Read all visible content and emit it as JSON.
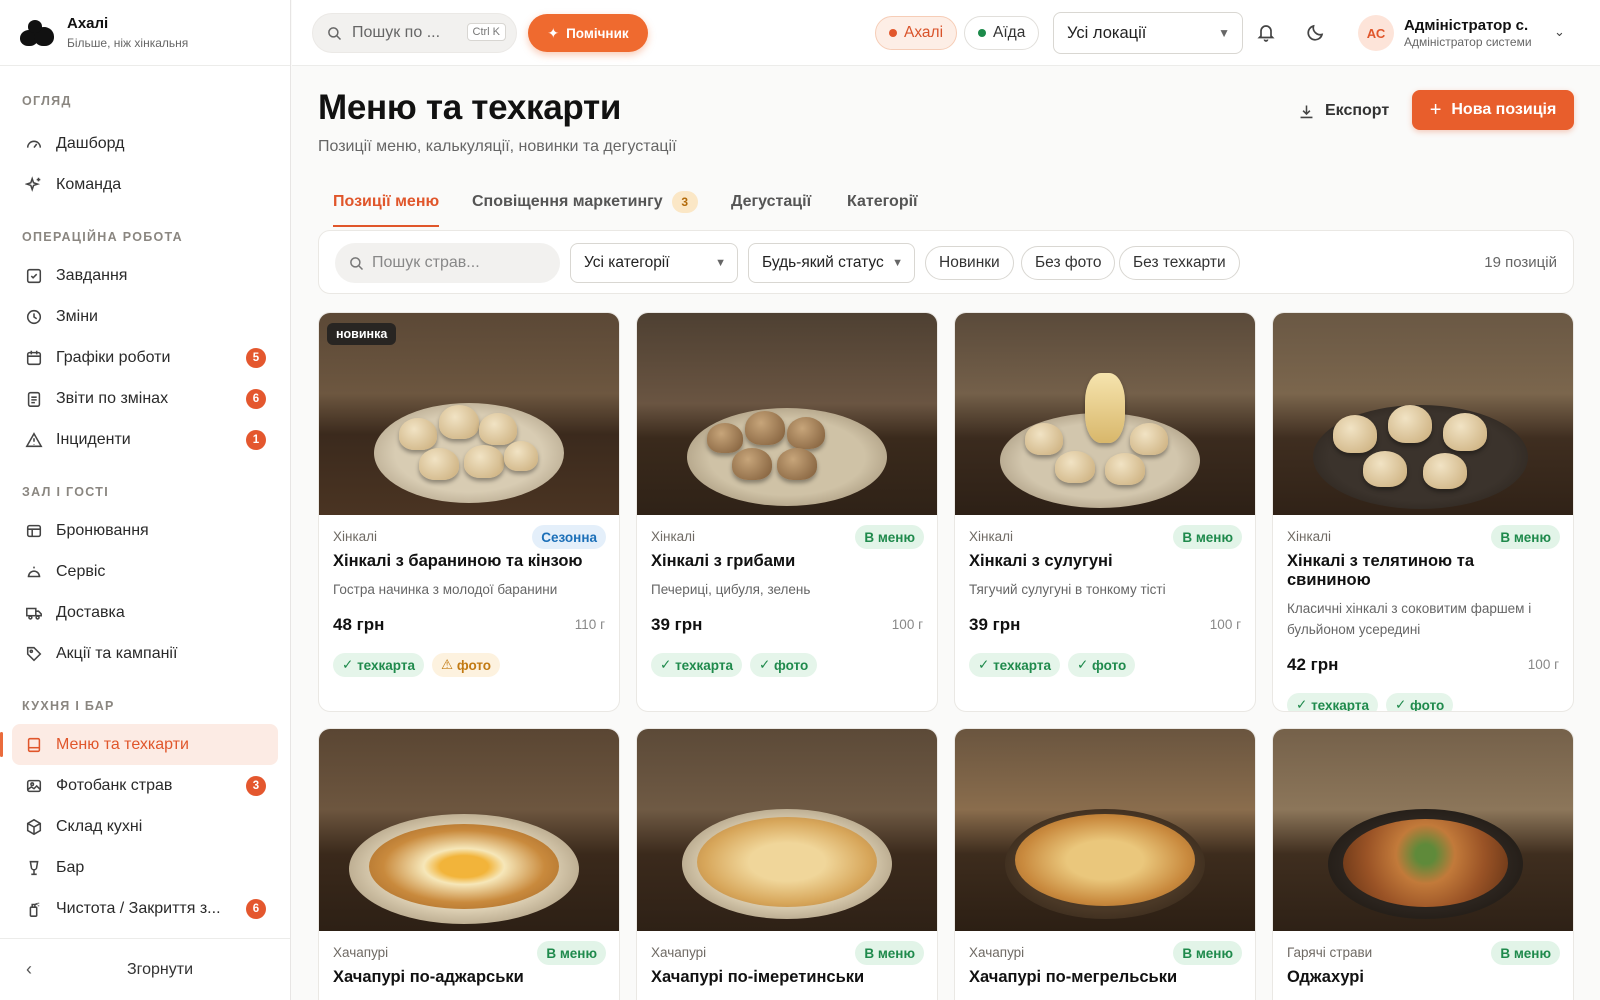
{
  "brand": {
    "name": "Ахалі",
    "tagline": "Більше, ніж хінкальня"
  },
  "sidebar": {
    "sections": [
      {
        "title": "ОГЛЯД"
      },
      {
        "title": "ОПЕРАЦІЙНА РОБОТА"
      },
      {
        "title": "ЗАЛ І ГОСТІ"
      },
      {
        "title": "КУХНЯ І БАР"
      }
    ],
    "items": [
      {
        "label": "Дашборд",
        "icon": "gauge-icon"
      },
      {
        "label": "Команда",
        "icon": "sparkles-icon"
      },
      {
        "label": "Завдання",
        "icon": "checkbox-icon"
      },
      {
        "label": "Зміни",
        "icon": "clock-icon"
      },
      {
        "label": "Графіки роботи",
        "icon": "calendar-icon",
        "badge": "5"
      },
      {
        "label": "Звіти по змінах",
        "icon": "clipboard-icon",
        "badge": "6"
      },
      {
        "label": "Інциденти",
        "icon": "warning-icon",
        "badge": "1"
      },
      {
        "label": "Бронювання",
        "icon": "table-icon"
      },
      {
        "label": "Сервіс",
        "icon": "cloche-icon"
      },
      {
        "label": "Доставка",
        "icon": "truck-icon"
      },
      {
        "label": "Акції та кампанії",
        "icon": "tag-icon"
      },
      {
        "label": "Меню та техкарти",
        "icon": "book-icon"
      },
      {
        "label": "Фотобанк страв",
        "icon": "image-icon",
        "badge": "3"
      },
      {
        "label": "Склад кухні",
        "icon": "box-icon"
      },
      {
        "label": "Бар",
        "icon": "glass-icon"
      },
      {
        "label": "Чистота / Закриття з...",
        "icon": "spray-icon",
        "badge": "6"
      }
    ],
    "collapse_label": "Згорнути"
  },
  "topbar": {
    "search_placeholder": "Пошук по ...",
    "shortcut": "Ctrl K",
    "assistant_label": "Помічник",
    "locations": [
      "Ахалі",
      "Аїда"
    ],
    "location_select": "Усі локації",
    "user": {
      "initials": "АС",
      "name": "Адміністратор с.",
      "role": "Адміністратор системи"
    }
  },
  "page": {
    "title": "Меню та техкарти",
    "subtitle": "Позиції меню, калькуляції, новинки та дегустації",
    "export_label": "Експорт",
    "new_label": "Нова позиція"
  },
  "tabs": [
    {
      "label": "Позиції меню"
    },
    {
      "label": "Сповіщення маркетингу",
      "badge": "3"
    },
    {
      "label": "Дегустації"
    },
    {
      "label": "Категорії"
    }
  ],
  "filters": {
    "search_placeholder": "Пошук страв...",
    "category_select": "Усі категорії",
    "status_select": "Будь-який статус",
    "chips": [
      "Новинки",
      "Без фото",
      "Без техкарти"
    ],
    "count": "19 позицій"
  },
  "cards": [
    {
      "category": "Хінкалі",
      "status": "Сезонна",
      "status_type": "season",
      "name": "Хінкалі з бараниною та кінзою",
      "desc": "Гостра начинка з молодої баранини",
      "price": "48 грн",
      "weight": "110 г",
      "badge": "новинка",
      "tags": [
        {
          "label": "техкарта",
          "type": "ok"
        },
        {
          "label": "фото",
          "type": "warn"
        }
      ]
    },
    {
      "category": "Хінкалі",
      "status": "В меню",
      "status_type": "onmenu",
      "name": "Хінкалі з грибами",
      "desc": "Печериці, цибуля, зелень",
      "price": "39 грн",
      "weight": "100 г",
      "tags": [
        {
          "label": "техкарта",
          "type": "ok"
        },
        {
          "label": "фото",
          "type": "ok"
        }
      ]
    },
    {
      "category": "Хінкалі",
      "status": "В меню",
      "status_type": "onmenu",
      "name": "Хінкалі з сулугуні",
      "desc": "Тягучий сулугуні в тонкому тісті",
      "price": "39 грн",
      "weight": "100 г",
      "tags": [
        {
          "label": "техкарта",
          "type": "ok"
        },
        {
          "label": "фото",
          "type": "ok"
        }
      ]
    },
    {
      "category": "Хінкалі",
      "status": "В меню",
      "status_type": "onmenu",
      "name": "Хінкалі з телятиною та свининою",
      "desc": "Класичні хінкалі з соковитим фаршем і бульйоном усередині",
      "price": "42 грн",
      "weight": "100 г",
      "tags": [
        {
          "label": "техкарта",
          "type": "ok"
        },
        {
          "label": "фото",
          "type": "ok"
        }
      ]
    },
    {
      "category": "Хачапурі",
      "status": "В меню",
      "status_type": "onmenu",
      "name": "Хачапурі по-аджарськи"
    },
    {
      "category": "Хачапурі",
      "status": "В меню",
      "status_type": "onmenu",
      "name": "Хачапурі по-імеретинськи"
    },
    {
      "category": "Хачапурі",
      "status": "В меню",
      "status_type": "onmenu",
      "name": "Хачапурі по-мегрельськи"
    },
    {
      "category": "Гарячі страви",
      "status": "В меню",
      "status_type": "onmenu",
      "name": "Оджахурі"
    }
  ],
  "colors": {
    "accent": "#e85e2c",
    "success": "#1f8a4c",
    "warning": "#c27a12",
    "info": "#1b6fb8"
  }
}
